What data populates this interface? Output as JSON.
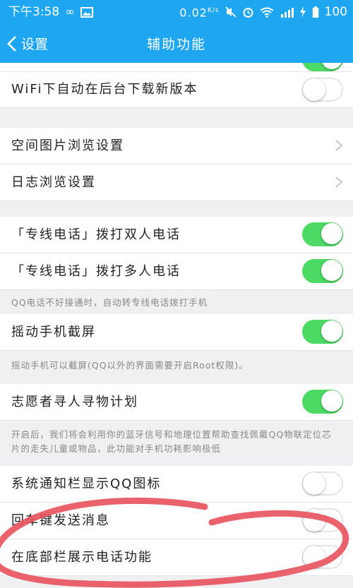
{
  "status_bar": {
    "time": "下午3:58",
    "speed": "0.02",
    "speed_unit": "K/s",
    "battery": "100"
  },
  "nav": {
    "back_label": "设置",
    "title": "辅助功能"
  },
  "rows": {
    "top_partial_toggle": "on",
    "wifi_update": {
      "label": "WiFi下自动在后台下载新版本",
      "toggle": "off"
    },
    "qzone_photo": {
      "label": "空间图片浏览设置"
    },
    "diary_browse": {
      "label": "日志浏览设置"
    },
    "call_double": {
      "label": "「专线电话」拨打双人电话",
      "toggle": "on"
    },
    "call_multi": {
      "label": "「专线电话」拨打多人电话",
      "toggle": "on"
    },
    "call_note": "QQ电话不好接通时，自动转专线电话拨打手机",
    "shake_screenshot": {
      "label": "摇动手机截屏",
      "toggle": "on"
    },
    "shake_note": "摇动手机可以截屏(QQ以外的界面需要开启Root权限)。",
    "volunteer": {
      "label": "志愿者寻人寻物计划",
      "toggle": "on"
    },
    "volunteer_note": "开启后，我们将会利用你的蓝牙信号和地理位置帮助查找佩戴QQ物联定位芯片的走失儿童或物品，此功能对手机功耗影响极低",
    "notify_icon": {
      "label": "系统通知栏显示QQ图标",
      "toggle": "off"
    },
    "enter_send": {
      "label": "回车键发送消息",
      "toggle": "off"
    },
    "bottom_call": {
      "label": "在底部栏展示电话功能",
      "toggle": "off"
    }
  },
  "colors": {
    "accent_blue": "#1ea7f0",
    "toggle_on": "#4cd964",
    "annotation_red": "#e8555f"
  }
}
